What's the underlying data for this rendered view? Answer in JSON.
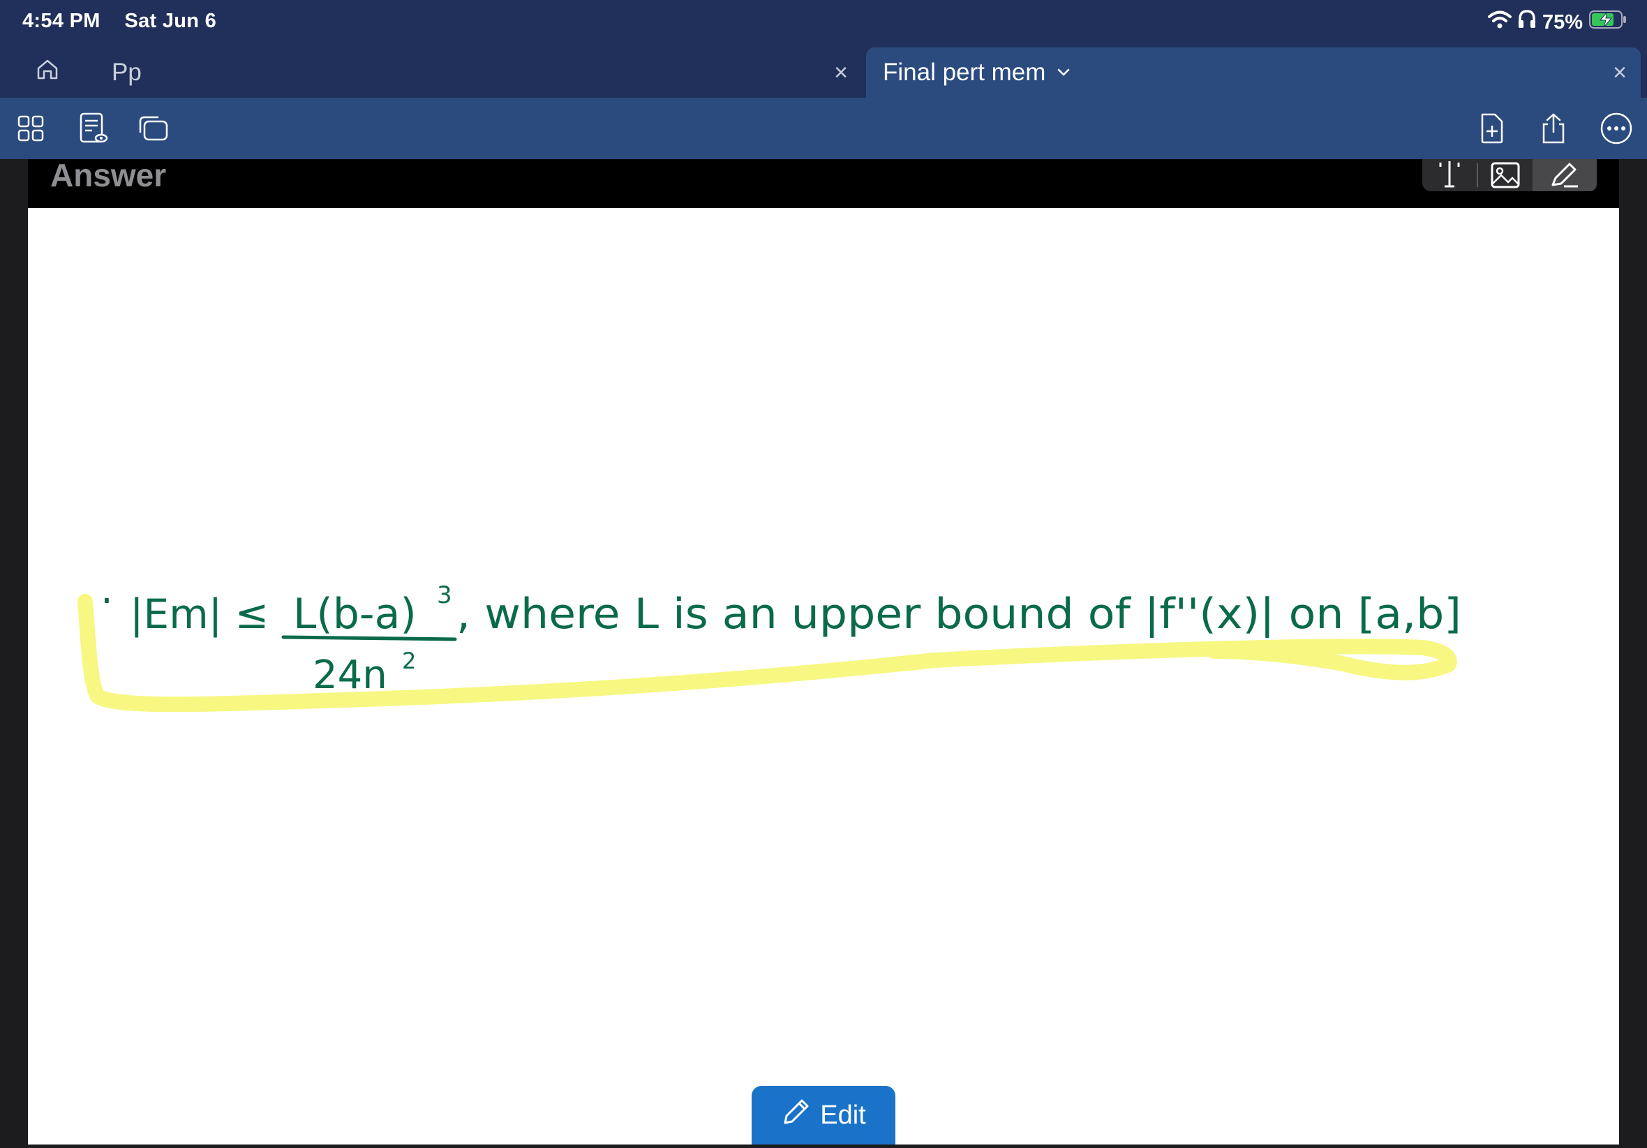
{
  "status_bar": {
    "time": "4:54 PM",
    "date": "Sat Jun 6",
    "battery": "75%",
    "icons": [
      "wifi-icon",
      "headphones-icon",
      "battery-charging-icon"
    ]
  },
  "tabs": {
    "home_icon": "home-icon",
    "inactive_tab": "Pp",
    "active_tab": "Final pert mem",
    "close_glyph": "×"
  },
  "toolbar": {
    "left_icons": [
      "grid-view-icon",
      "document-view-icon",
      "windows-icon"
    ],
    "right_icons": [
      "add-page-icon",
      "share-icon",
      "more-icon"
    ]
  },
  "page": {
    "section_title": "Answer",
    "tool_icons": [
      "text-tool-icon",
      "image-tool-icon",
      "pen-tool-icon"
    ],
    "handwriting": {
      "bullet": "·",
      "lhs": "|Em| ≤",
      "numerator": "L(b-a)",
      "exponent": "3",
      "denominator": "24n",
      "denominator_exponent": "2",
      "rest": ", where L is an upper bound of |f''(x)| on [a,b]"
    },
    "colors": {
      "ink": "#0a6a4c",
      "highlighter": "#f7f77a"
    }
  },
  "edit_button": {
    "label": "Edit",
    "icon": "pencil-icon"
  },
  "colors": {
    "status_bg": "#21305a",
    "toolbar_bg": "#2b4b7e",
    "edit_bg": "#1a73c8"
  }
}
